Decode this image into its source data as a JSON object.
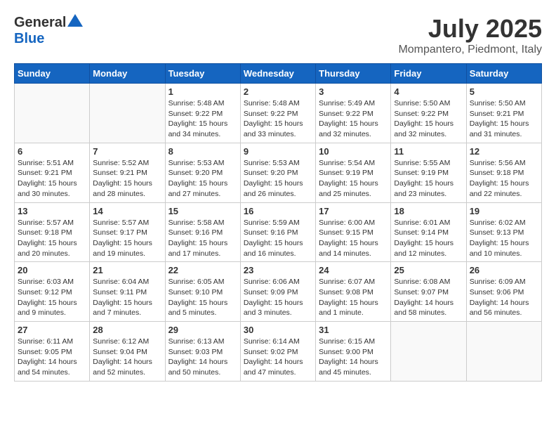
{
  "header": {
    "logo_general": "General",
    "logo_blue": "Blue",
    "month_year": "July 2025",
    "location": "Mompantero, Piedmont, Italy"
  },
  "days_of_week": [
    "Sunday",
    "Monday",
    "Tuesday",
    "Wednesday",
    "Thursday",
    "Friday",
    "Saturday"
  ],
  "weeks": [
    [
      {
        "day": "",
        "info": ""
      },
      {
        "day": "",
        "info": ""
      },
      {
        "day": "1",
        "info": "Sunrise: 5:48 AM\nSunset: 9:22 PM\nDaylight: 15 hours and 34 minutes."
      },
      {
        "day": "2",
        "info": "Sunrise: 5:48 AM\nSunset: 9:22 PM\nDaylight: 15 hours and 33 minutes."
      },
      {
        "day": "3",
        "info": "Sunrise: 5:49 AM\nSunset: 9:22 PM\nDaylight: 15 hours and 32 minutes."
      },
      {
        "day": "4",
        "info": "Sunrise: 5:50 AM\nSunset: 9:22 PM\nDaylight: 15 hours and 32 minutes."
      },
      {
        "day": "5",
        "info": "Sunrise: 5:50 AM\nSunset: 9:21 PM\nDaylight: 15 hours and 31 minutes."
      }
    ],
    [
      {
        "day": "6",
        "info": "Sunrise: 5:51 AM\nSunset: 9:21 PM\nDaylight: 15 hours and 30 minutes."
      },
      {
        "day": "7",
        "info": "Sunrise: 5:52 AM\nSunset: 9:21 PM\nDaylight: 15 hours and 28 minutes."
      },
      {
        "day": "8",
        "info": "Sunrise: 5:53 AM\nSunset: 9:20 PM\nDaylight: 15 hours and 27 minutes."
      },
      {
        "day": "9",
        "info": "Sunrise: 5:53 AM\nSunset: 9:20 PM\nDaylight: 15 hours and 26 minutes."
      },
      {
        "day": "10",
        "info": "Sunrise: 5:54 AM\nSunset: 9:19 PM\nDaylight: 15 hours and 25 minutes."
      },
      {
        "day": "11",
        "info": "Sunrise: 5:55 AM\nSunset: 9:19 PM\nDaylight: 15 hours and 23 minutes."
      },
      {
        "day": "12",
        "info": "Sunrise: 5:56 AM\nSunset: 9:18 PM\nDaylight: 15 hours and 22 minutes."
      }
    ],
    [
      {
        "day": "13",
        "info": "Sunrise: 5:57 AM\nSunset: 9:18 PM\nDaylight: 15 hours and 20 minutes."
      },
      {
        "day": "14",
        "info": "Sunrise: 5:57 AM\nSunset: 9:17 PM\nDaylight: 15 hours and 19 minutes."
      },
      {
        "day": "15",
        "info": "Sunrise: 5:58 AM\nSunset: 9:16 PM\nDaylight: 15 hours and 17 minutes."
      },
      {
        "day": "16",
        "info": "Sunrise: 5:59 AM\nSunset: 9:16 PM\nDaylight: 15 hours and 16 minutes."
      },
      {
        "day": "17",
        "info": "Sunrise: 6:00 AM\nSunset: 9:15 PM\nDaylight: 15 hours and 14 minutes."
      },
      {
        "day": "18",
        "info": "Sunrise: 6:01 AM\nSunset: 9:14 PM\nDaylight: 15 hours and 12 minutes."
      },
      {
        "day": "19",
        "info": "Sunrise: 6:02 AM\nSunset: 9:13 PM\nDaylight: 15 hours and 10 minutes."
      }
    ],
    [
      {
        "day": "20",
        "info": "Sunrise: 6:03 AM\nSunset: 9:12 PM\nDaylight: 15 hours and 9 minutes."
      },
      {
        "day": "21",
        "info": "Sunrise: 6:04 AM\nSunset: 9:11 PM\nDaylight: 15 hours and 7 minutes."
      },
      {
        "day": "22",
        "info": "Sunrise: 6:05 AM\nSunset: 9:10 PM\nDaylight: 15 hours and 5 minutes."
      },
      {
        "day": "23",
        "info": "Sunrise: 6:06 AM\nSunset: 9:09 PM\nDaylight: 15 hours and 3 minutes."
      },
      {
        "day": "24",
        "info": "Sunrise: 6:07 AM\nSunset: 9:08 PM\nDaylight: 15 hours and 1 minute."
      },
      {
        "day": "25",
        "info": "Sunrise: 6:08 AM\nSunset: 9:07 PM\nDaylight: 14 hours and 58 minutes."
      },
      {
        "day": "26",
        "info": "Sunrise: 6:09 AM\nSunset: 9:06 PM\nDaylight: 14 hours and 56 minutes."
      }
    ],
    [
      {
        "day": "27",
        "info": "Sunrise: 6:11 AM\nSunset: 9:05 PM\nDaylight: 14 hours and 54 minutes."
      },
      {
        "day": "28",
        "info": "Sunrise: 6:12 AM\nSunset: 9:04 PM\nDaylight: 14 hours and 52 minutes."
      },
      {
        "day": "29",
        "info": "Sunrise: 6:13 AM\nSunset: 9:03 PM\nDaylight: 14 hours and 50 minutes."
      },
      {
        "day": "30",
        "info": "Sunrise: 6:14 AM\nSunset: 9:02 PM\nDaylight: 14 hours and 47 minutes."
      },
      {
        "day": "31",
        "info": "Sunrise: 6:15 AM\nSunset: 9:00 PM\nDaylight: 14 hours and 45 minutes."
      },
      {
        "day": "",
        "info": ""
      },
      {
        "day": "",
        "info": ""
      }
    ]
  ]
}
